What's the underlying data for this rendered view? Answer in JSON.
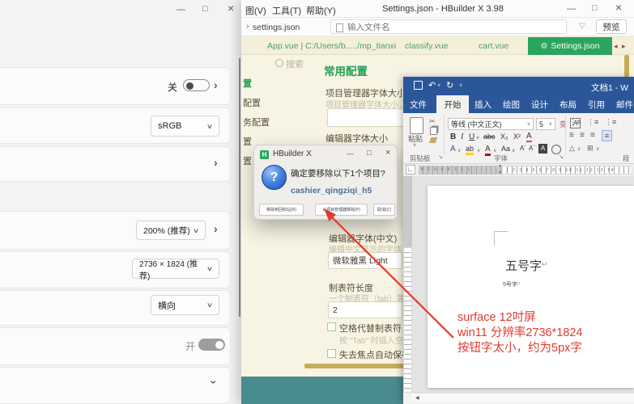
{
  "glyphs": {
    "minimize": "—",
    "maximize": "□",
    "close": "×",
    "chevron_right": "›",
    "caret": "∨",
    "filter": "▽",
    "gear": "⚙",
    "tab_back": "◂",
    "tab_forward": "▸",
    "undo": "↶",
    "redo": "↻",
    "pilcrow": "↵",
    "scroll_left": "◀",
    "cut": "✂",
    "launcher": "↘",
    "tab_stop": "∟",
    "indent_top": "▾",
    "indent_bottom": "▴",
    "list_icon": "⋮≡",
    "align_icon": "≡",
    "shading_icon": "△",
    "border_icon": "⊞"
  },
  "settings_panel": {
    "toggle_off_label": "关",
    "color_value": "sRGB",
    "scale_value": "200% (推荐)",
    "resolution_value": "2736 × 1824 (推荐)",
    "orientation_value": "横向",
    "toggle_on_label": "开"
  },
  "hbuilder": {
    "menu": {
      "view": "图(V)",
      "tools": "工具(T)",
      "help": "帮助(Y)"
    },
    "window_title": "Settings.json - HBuilder X 3.98",
    "breadcrumb": "settings.json",
    "search_placeholder": "输入文件名",
    "preview_label": "预览",
    "tabs": {
      "tab1": "App.vue | C:/Users/b...../mp_tianxi",
      "tab2": "classify.vue",
      "tab3": "cart.vue",
      "active": "Settings.json"
    },
    "sidebar": {
      "search_label": "搜索",
      "item1": "置",
      "item2": "配置",
      "item3": "务配置",
      "item4": "置",
      "item5": "置"
    },
    "settings_page": {
      "heading": "常用配置",
      "field1_label": "项目管理器字体大小",
      "field1_hint": "项目管理器字体大小，单",
      "field2_label": "编辑器字体大小",
      "field3_label": "编辑器字体(中文)",
      "field3_hint": "编辑中文显示的字体，需",
      "field3_value": "微软雅黑 Light",
      "field4_label": "制表符长度",
      "field4_hint": "一个制表符（tab）等于的",
      "field4_value": "2",
      "check1_label": "空格代替制表符",
      "check1_hint": "按 \"Tab\" 时插入空格，",
      "check2_label": "失去焦点自动保存"
    }
  },
  "dialog": {
    "app_name": "HBuilder X",
    "logo_letter": "H",
    "message": "确定要移除以下1个项目?",
    "question_mark": "?",
    "project_name": "cashier_qingziqi_h5",
    "btn_recycle": "移除到回收站(R)",
    "btn_remove": "从项目管理器移除(P)",
    "btn_cancel": "取消(C)"
  },
  "word": {
    "doc_title": "文档1 - W",
    "tabs": {
      "file": "文件",
      "home": "开始",
      "insert": "插入",
      "draw": "绘图",
      "design": "设计",
      "layout": "布局",
      "references": "引用",
      "mailings": "邮件"
    },
    "paste_label": "粘贴",
    "font_name": "等线 (中文正文)",
    "font_size": "5",
    "font_buttons": {
      "bold": "B",
      "italic": "I",
      "underline": "U",
      "strike": "abc",
      "sub": "X₂",
      "sup": "X²",
      "effects": "A",
      "highlight": "ab",
      "color": "A",
      "case": "Aa",
      "grow": "A´",
      "shrink": "A`",
      "boxed": "A",
      "phonetic": "变",
      "char_border": "A"
    },
    "group_clipboard": "剪贴板",
    "group_font": "字体",
    "group_paragraph": "段",
    "ruler_left": "8 7 6 5 4 3 2 1",
    "ruler_right": "1 2 3 4 5 6 7 8 9 10 11 12 13 14",
    "doc_text_large": "五号字",
    "doc_text_small": "5号字"
  },
  "annotation": {
    "color": "#e23a2e",
    "line1": "surface 12吋屏",
    "line2": "win11 分辨率2736*1824",
    "line3": "按钮字太小，约为5px字"
  }
}
